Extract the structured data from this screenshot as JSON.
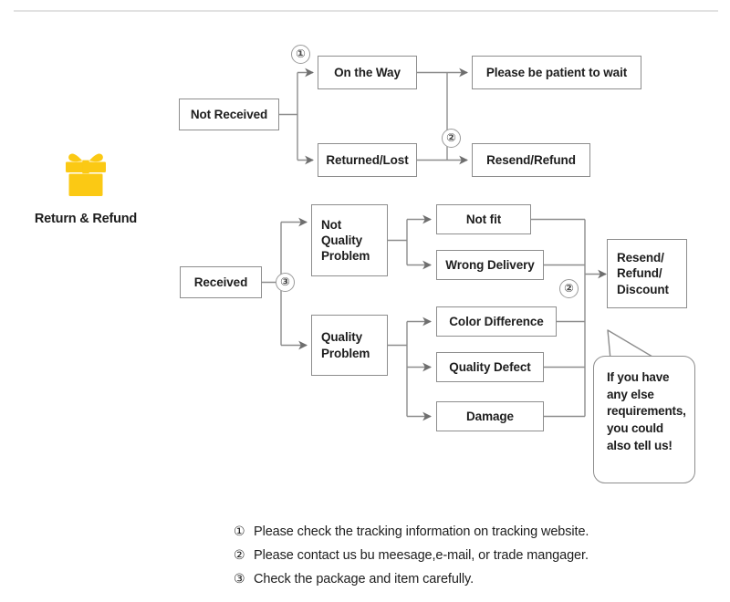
{
  "brand": {
    "icon": "gift-box-icon",
    "icon_color": "#FBC914",
    "caption": "Return & Refund"
  },
  "colors": {
    "box_border": "#8d8d8d",
    "wire": "#8d8d8d",
    "text": "#1d1d1d",
    "circle_border": "#9a9a9a",
    "divider": "#e2e2e2",
    "gift_yellow": "#FBC914"
  },
  "flow": {
    "not_received": {
      "root": "Not Received",
      "marker_one": "①",
      "branches": [
        {
          "label": "On the Way"
        },
        {
          "label": "Returned/Lost"
        }
      ],
      "outcomes": [
        {
          "label": "Please be patient to wait"
        },
        {
          "label": "Resend/Refund",
          "marker": "②"
        }
      ]
    },
    "received": {
      "root": "Received",
      "marker_three": "③",
      "marker_two": "②",
      "categories": [
        {
          "label": "Not Quality Problem"
        },
        {
          "label": "Quality Problem"
        }
      ],
      "reasons_not_quality": [
        {
          "label": "Not fit"
        },
        {
          "label": "Wrong Delivery"
        }
      ],
      "reasons_quality": [
        {
          "label": "Color Difference"
        },
        {
          "label": "Quality Defect"
        },
        {
          "label": "Damage"
        }
      ],
      "result": "Resend/ Refund/ Discount"
    }
  },
  "bubble": {
    "text": "If you have any else requirements, you could also tell us!"
  },
  "notes": [
    {
      "marker": "①",
      "text": "Please check the tracking information on tracking website."
    },
    {
      "marker": "②",
      "text": "Please contact us bu meesage,e-mail, or trade mangager."
    },
    {
      "marker": "③",
      "text": "Check the package and item carefully."
    }
  ]
}
